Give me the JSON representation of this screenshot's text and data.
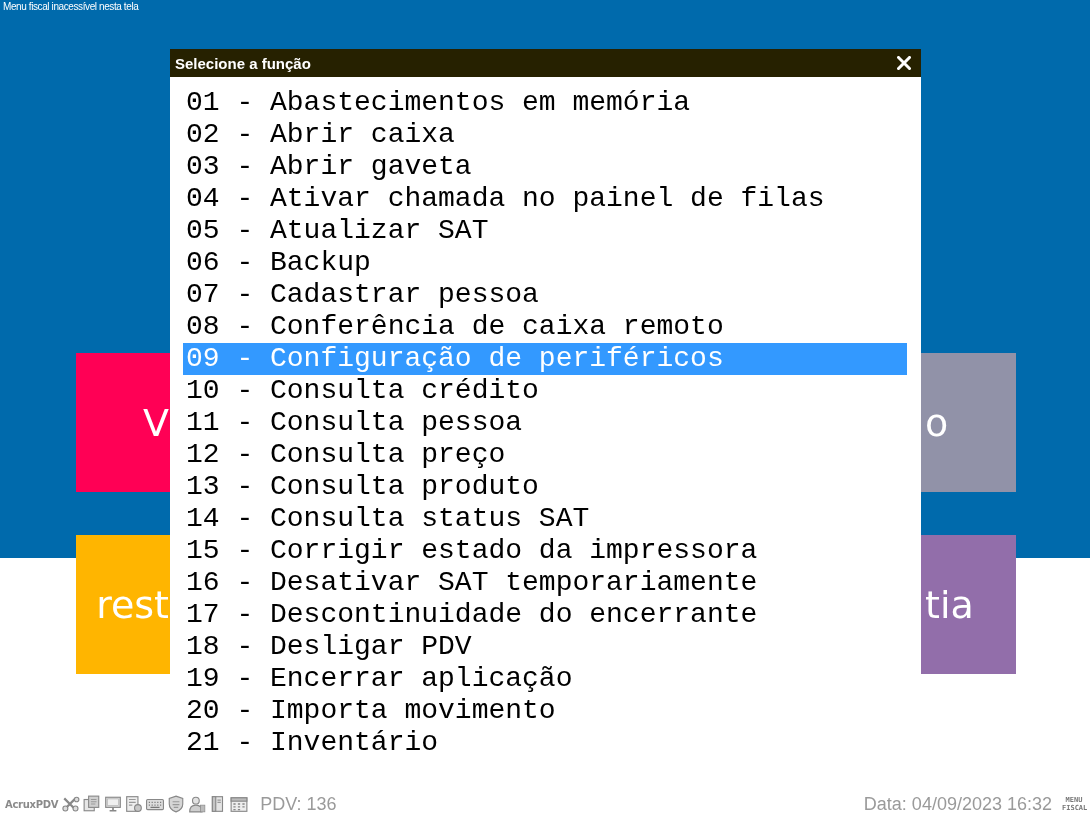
{
  "notice": "Menu fiscal inacessível nesta tela",
  "tiles": [
    {
      "label": "V",
      "color": "#ff0055"
    },
    {
      "label": "o",
      "color": "#9192a8"
    },
    {
      "label": "rest",
      "color": "#ffb500"
    },
    {
      "label": "tia",
      "color": "#926eaa"
    }
  ],
  "dialog": {
    "title": "Selecione a função",
    "items": [
      {
        "label": "01 - Abastecimentos em memória",
        "selected": false
      },
      {
        "label": "02 - Abrir caixa",
        "selected": false
      },
      {
        "label": "03 - Abrir gaveta",
        "selected": false
      },
      {
        "label": "04 - Ativar chamada no painel de filas",
        "selected": false
      },
      {
        "label": "05 - Atualizar SAT",
        "selected": false
      },
      {
        "label": "06 - Backup",
        "selected": false
      },
      {
        "label": "07 - Cadastrar pessoa",
        "selected": false
      },
      {
        "label": "08 - Conferência de caixa remoto",
        "selected": false
      },
      {
        "label": "09 - Configuração de periféricos",
        "selected": true
      },
      {
        "label": "10 - Consulta crédito",
        "selected": false
      },
      {
        "label": "11 - Consulta pessoa",
        "selected": false
      },
      {
        "label": "12 - Consulta preço",
        "selected": false
      },
      {
        "label": "13 - Consulta produto",
        "selected": false
      },
      {
        "label": "14 - Consulta status SAT",
        "selected": false
      },
      {
        "label": "15 - Corrigir estado da impressora",
        "selected": false
      },
      {
        "label": "16 - Desativar SAT temporariamente",
        "selected": false
      },
      {
        "label": "17 - Descontinuidade do encerrante",
        "selected": false
      },
      {
        "label": "18 - Desligar PDV",
        "selected": false
      },
      {
        "label": "19 - Encerrar aplicação",
        "selected": false
      },
      {
        "label": "20 - Importa movimento",
        "selected": false
      },
      {
        "label": "21 - Inventário",
        "selected": false
      }
    ]
  },
  "status_bar": {
    "app_name": "AcruxPDV",
    "pdv": "PDV: 136",
    "date": "Data: 04/09/2023 16:32",
    "menu_fiscal": "MENU FISCAL"
  }
}
